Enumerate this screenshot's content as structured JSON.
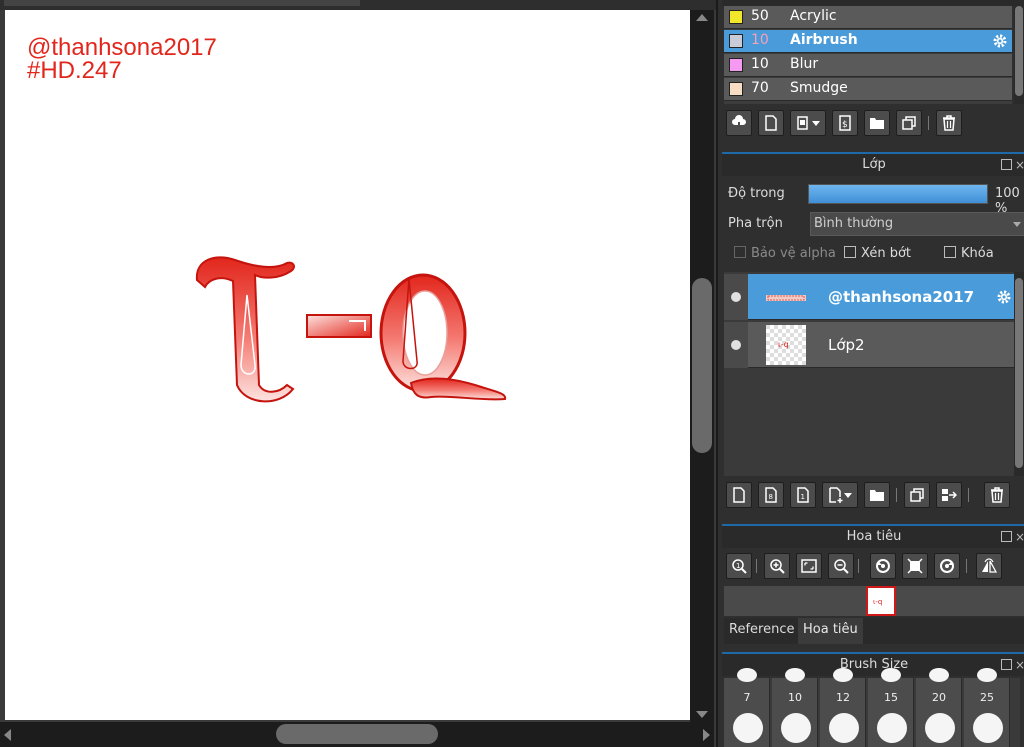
{
  "canvas": {
    "watermark_line1": "@thanhsona2017",
    "watermark_line2": "#HD.247",
    "artwork_colors": {
      "primary": "#e2261c",
      "light": "#ffd0cc"
    }
  },
  "brush_panel": {
    "items": [
      {
        "size": "50",
        "name": "Acrylic",
        "swatch": "#f2e62a",
        "selected": false
      },
      {
        "size": "10",
        "name": "Airbrush",
        "swatch": "#c9ccd6",
        "selected": true
      },
      {
        "size": "10",
        "name": "Blur",
        "swatch": "#f59af0",
        "selected": false
      },
      {
        "size": "70",
        "name": "Smudge",
        "swatch": "#f8dcc4",
        "selected": false
      }
    ],
    "toolbar_icons": [
      "cloud-download-icon",
      "new-brush-icon",
      "brush-add-menu-icon",
      "brush-script-icon",
      "folder-icon",
      "duplicate-icon",
      "trash-icon"
    ]
  },
  "layer_panel": {
    "title": "Lớp",
    "opacity_label": "Độ trong",
    "opacity_value": "100 %",
    "opacity_fraction": 1.0,
    "blend_label": "Pha trộn",
    "blend_value": "Bình thường",
    "protect_alpha_label": "Bảo vệ alpha",
    "clipping_label": "Xén bớt",
    "lock_label": "Khóa",
    "layers": [
      {
        "name": "@thanhsona2017",
        "selected": true
      },
      {
        "name": "Lớp2",
        "selected": false
      }
    ]
  },
  "navigator_panel": {
    "title": "Hoa tiêu",
    "tabs": [
      {
        "label": "Reference",
        "active": false
      },
      {
        "label": "Hoa tiêu",
        "active": true
      }
    ]
  },
  "brush_size_panel": {
    "title": "Brush Size",
    "sizes": [
      "7",
      "10",
      "12",
      "15",
      "20",
      "25"
    ]
  },
  "colors": {
    "accent": "#4a9bd9",
    "panel_bg": "#2f2f2f",
    "row_bg": "#5a5a5a"
  }
}
